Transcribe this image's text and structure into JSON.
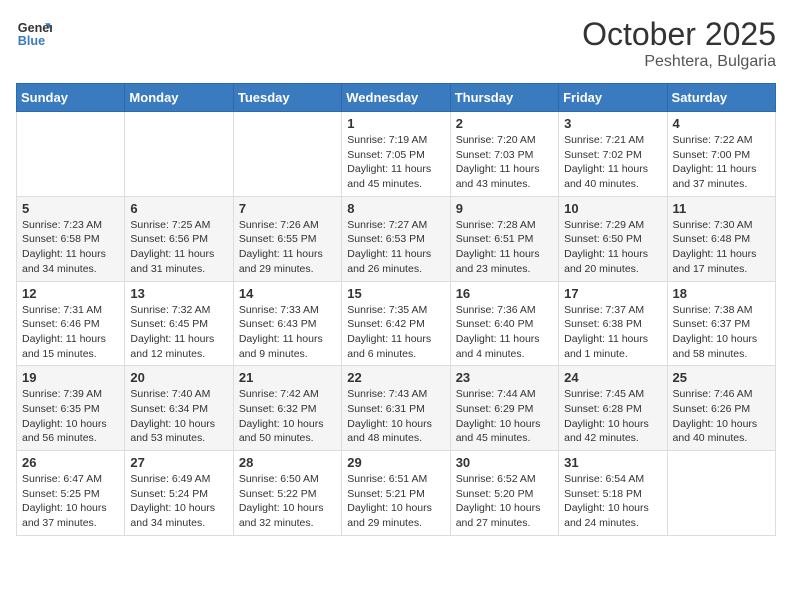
{
  "header": {
    "logo_line1": "General",
    "logo_line2": "Blue",
    "month": "October 2025",
    "location": "Peshtera, Bulgaria"
  },
  "weekdays": [
    "Sunday",
    "Monday",
    "Tuesday",
    "Wednesday",
    "Thursday",
    "Friday",
    "Saturday"
  ],
  "weeks": [
    [
      {
        "day": "",
        "info": ""
      },
      {
        "day": "",
        "info": ""
      },
      {
        "day": "",
        "info": ""
      },
      {
        "day": "1",
        "info": "Sunrise: 7:19 AM\nSunset: 7:05 PM\nDaylight: 11 hours and 45 minutes."
      },
      {
        "day": "2",
        "info": "Sunrise: 7:20 AM\nSunset: 7:03 PM\nDaylight: 11 hours and 43 minutes."
      },
      {
        "day": "3",
        "info": "Sunrise: 7:21 AM\nSunset: 7:02 PM\nDaylight: 11 hours and 40 minutes."
      },
      {
        "day": "4",
        "info": "Sunrise: 7:22 AM\nSunset: 7:00 PM\nDaylight: 11 hours and 37 minutes."
      }
    ],
    [
      {
        "day": "5",
        "info": "Sunrise: 7:23 AM\nSunset: 6:58 PM\nDaylight: 11 hours and 34 minutes."
      },
      {
        "day": "6",
        "info": "Sunrise: 7:25 AM\nSunset: 6:56 PM\nDaylight: 11 hours and 31 minutes."
      },
      {
        "day": "7",
        "info": "Sunrise: 7:26 AM\nSunset: 6:55 PM\nDaylight: 11 hours and 29 minutes."
      },
      {
        "day": "8",
        "info": "Sunrise: 7:27 AM\nSunset: 6:53 PM\nDaylight: 11 hours and 26 minutes."
      },
      {
        "day": "9",
        "info": "Sunrise: 7:28 AM\nSunset: 6:51 PM\nDaylight: 11 hours and 23 minutes."
      },
      {
        "day": "10",
        "info": "Sunrise: 7:29 AM\nSunset: 6:50 PM\nDaylight: 11 hours and 20 minutes."
      },
      {
        "day": "11",
        "info": "Sunrise: 7:30 AM\nSunset: 6:48 PM\nDaylight: 11 hours and 17 minutes."
      }
    ],
    [
      {
        "day": "12",
        "info": "Sunrise: 7:31 AM\nSunset: 6:46 PM\nDaylight: 11 hours and 15 minutes."
      },
      {
        "day": "13",
        "info": "Sunrise: 7:32 AM\nSunset: 6:45 PM\nDaylight: 11 hours and 12 minutes."
      },
      {
        "day": "14",
        "info": "Sunrise: 7:33 AM\nSunset: 6:43 PM\nDaylight: 11 hours and 9 minutes."
      },
      {
        "day": "15",
        "info": "Sunrise: 7:35 AM\nSunset: 6:42 PM\nDaylight: 11 hours and 6 minutes."
      },
      {
        "day": "16",
        "info": "Sunrise: 7:36 AM\nSunset: 6:40 PM\nDaylight: 11 hours and 4 minutes."
      },
      {
        "day": "17",
        "info": "Sunrise: 7:37 AM\nSunset: 6:38 PM\nDaylight: 11 hours and 1 minute."
      },
      {
        "day": "18",
        "info": "Sunrise: 7:38 AM\nSunset: 6:37 PM\nDaylight: 10 hours and 58 minutes."
      }
    ],
    [
      {
        "day": "19",
        "info": "Sunrise: 7:39 AM\nSunset: 6:35 PM\nDaylight: 10 hours and 56 minutes."
      },
      {
        "day": "20",
        "info": "Sunrise: 7:40 AM\nSunset: 6:34 PM\nDaylight: 10 hours and 53 minutes."
      },
      {
        "day": "21",
        "info": "Sunrise: 7:42 AM\nSunset: 6:32 PM\nDaylight: 10 hours and 50 minutes."
      },
      {
        "day": "22",
        "info": "Sunrise: 7:43 AM\nSunset: 6:31 PM\nDaylight: 10 hours and 48 minutes."
      },
      {
        "day": "23",
        "info": "Sunrise: 7:44 AM\nSunset: 6:29 PM\nDaylight: 10 hours and 45 minutes."
      },
      {
        "day": "24",
        "info": "Sunrise: 7:45 AM\nSunset: 6:28 PM\nDaylight: 10 hours and 42 minutes."
      },
      {
        "day": "25",
        "info": "Sunrise: 7:46 AM\nSunset: 6:26 PM\nDaylight: 10 hours and 40 minutes."
      }
    ],
    [
      {
        "day": "26",
        "info": "Sunrise: 6:47 AM\nSunset: 5:25 PM\nDaylight: 10 hours and 37 minutes."
      },
      {
        "day": "27",
        "info": "Sunrise: 6:49 AM\nSunset: 5:24 PM\nDaylight: 10 hours and 34 minutes."
      },
      {
        "day": "28",
        "info": "Sunrise: 6:50 AM\nSunset: 5:22 PM\nDaylight: 10 hours and 32 minutes."
      },
      {
        "day": "29",
        "info": "Sunrise: 6:51 AM\nSunset: 5:21 PM\nDaylight: 10 hours and 29 minutes."
      },
      {
        "day": "30",
        "info": "Sunrise: 6:52 AM\nSunset: 5:20 PM\nDaylight: 10 hours and 27 minutes."
      },
      {
        "day": "31",
        "info": "Sunrise: 6:54 AM\nSunset: 5:18 PM\nDaylight: 10 hours and 24 minutes."
      },
      {
        "day": "",
        "info": ""
      }
    ]
  ]
}
